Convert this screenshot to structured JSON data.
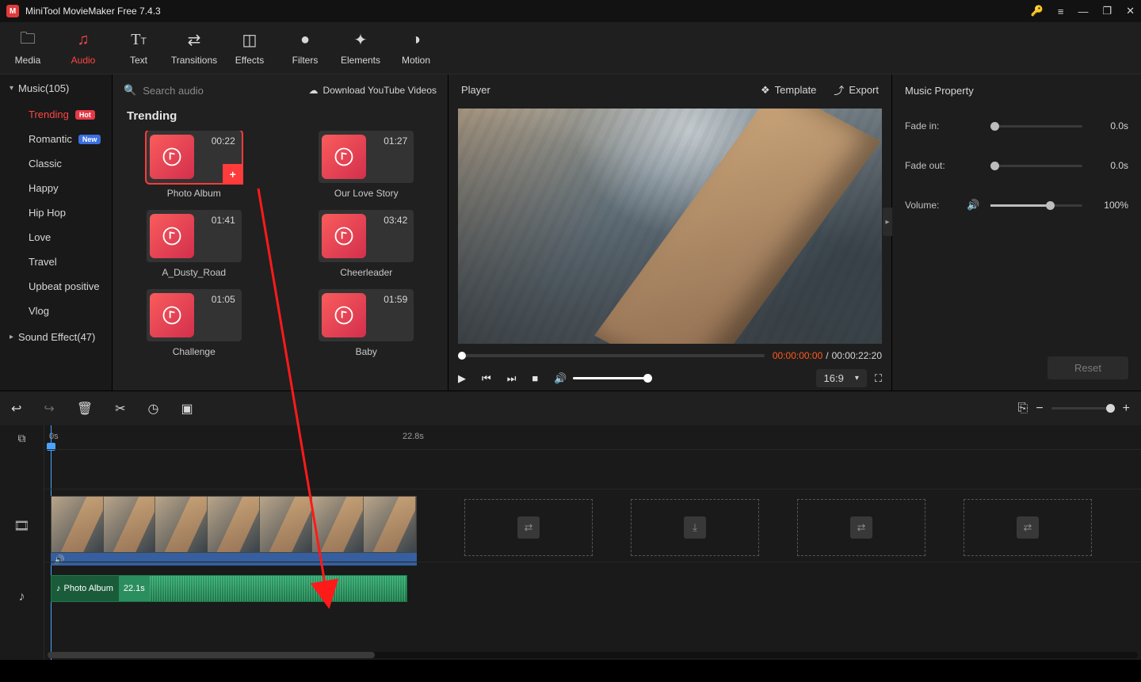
{
  "app": {
    "title": "MiniTool MovieMaker Free 7.4.3"
  },
  "topTabs": [
    {
      "id": "media",
      "label": "Media"
    },
    {
      "id": "audio",
      "label": "Audio"
    },
    {
      "id": "text",
      "label": "Text"
    },
    {
      "id": "transitions",
      "label": "Transitions"
    },
    {
      "id": "effects",
      "label": "Effects"
    },
    {
      "id": "filters",
      "label": "Filters"
    },
    {
      "id": "elements",
      "label": "Elements"
    },
    {
      "id": "motion",
      "label": "Motion"
    }
  ],
  "sidebar": {
    "groups": [
      {
        "label": "Music(105)",
        "expanded": true
      },
      {
        "label": "Sound Effect(47)",
        "expanded": false
      }
    ],
    "items": [
      {
        "label": "Trending",
        "badge": "Hot",
        "badgeClass": "hot",
        "active": true
      },
      {
        "label": "Romantic",
        "badge": "New",
        "badgeClass": "new"
      },
      {
        "label": "Classic"
      },
      {
        "label": "Happy"
      },
      {
        "label": "Hip Hop"
      },
      {
        "label": "Love"
      },
      {
        "label": "Travel"
      },
      {
        "label": "Upbeat positive"
      },
      {
        "label": "Vlog"
      }
    ]
  },
  "browser": {
    "searchPlaceholder": "Search audio",
    "downloadLabel": "Download YouTube Videos",
    "heading": "Trending",
    "items": [
      {
        "name": "Photo Album",
        "dur": "00:22",
        "selected": true,
        "add": true
      },
      {
        "name": "Our Love Story",
        "dur": "01:27"
      },
      {
        "name": "A_Dusty_Road",
        "dur": "01:41"
      },
      {
        "name": "Cheerleader",
        "dur": "03:42"
      },
      {
        "name": "Challenge",
        "dur": "01:05"
      },
      {
        "name": "Baby",
        "dur": "01:59"
      }
    ]
  },
  "player": {
    "title": "Player",
    "templateLabel": "Template",
    "exportLabel": "Export",
    "timeCurrent": "00:00:00:00",
    "timeSep": " / ",
    "timeTotal": "00:00:22:20",
    "aspect": "16:9"
  },
  "props": {
    "title": "Music Property",
    "fadeInLabel": "Fade in:",
    "fadeInVal": "0.0s",
    "fadeOutLabel": "Fade out:",
    "fadeOutVal": "0.0s",
    "volumeLabel": "Volume:",
    "volumeVal": "100%",
    "resetLabel": "Reset"
  },
  "timeline": {
    "ruler": {
      "mark0": "0s",
      "mark1": "22.8s"
    },
    "audioClip": {
      "name": "Photo Album",
      "dur": "22.1s"
    }
  }
}
